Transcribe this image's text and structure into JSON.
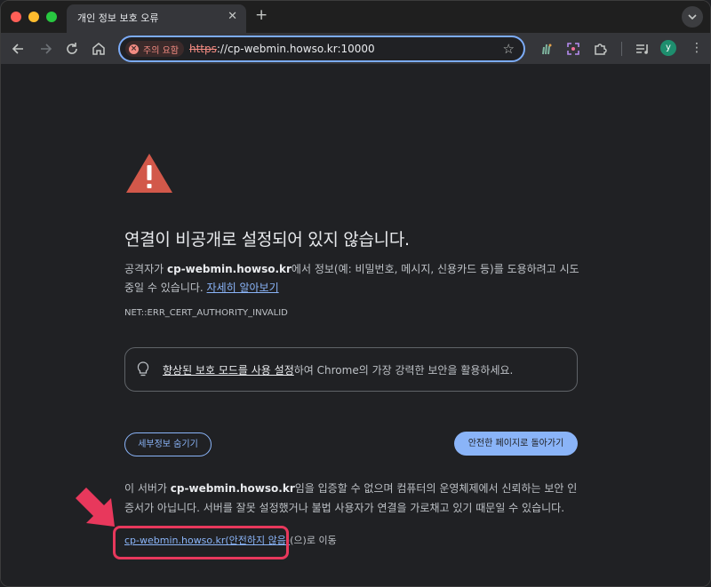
{
  "tab": {
    "title": "개인 정보 보호 오류",
    "close": "✕",
    "new_tab": "+"
  },
  "omnibox": {
    "warning_label": "주의 요함",
    "url_scheme": "https",
    "url_rest": "://cp-webmin.howso.kr:10000"
  },
  "toolbar": {
    "avatar_letter": "y"
  },
  "page": {
    "heading": "연결이 비공개로 설정되어 있지 않습니다.",
    "para1_a": "공격자가 ",
    "para1_host": "cp-webmin.howso.kr",
    "para1_b": "에서 정보(예: 비밀번호, 메시지, 신용카드 등)를 도용하려고 시도 중일 수 있습니다. ",
    "learn_more": "자세히 알아보기",
    "error_code": "NET::ERR_CERT_AUTHORITY_INVALID",
    "enhanced_link": "향상된 보호 모드를 사용 설정",
    "enhanced_rest": "하여 Chrome의 가장 강력한 보안을 활용하세요.",
    "hide_details": "세부정보 숨기기",
    "back_to_safety": "안전한 페이지로 돌아가기",
    "para2_a": "이 서버가 ",
    "para2_host": "cp-webmin.howso.kr",
    "para2_b": "임을 입증할 수 없으며 컴퓨터의 운영체제에서 신뢰하는 보안 인증서가 아닙니다. 서버를 잘못 설정했거나 불법 사용자가 연결을 가로채고 있기 때문일 수 있습니다.",
    "proceed_link": "cp-webmin.howso.kr(안전하지 않음)",
    "proceed_suffix": "(으)로 이동"
  },
  "colors": {
    "accent": "#8ab4f8",
    "warning": "#f28b82",
    "highlight": "#e8385c",
    "background": "#202124"
  }
}
